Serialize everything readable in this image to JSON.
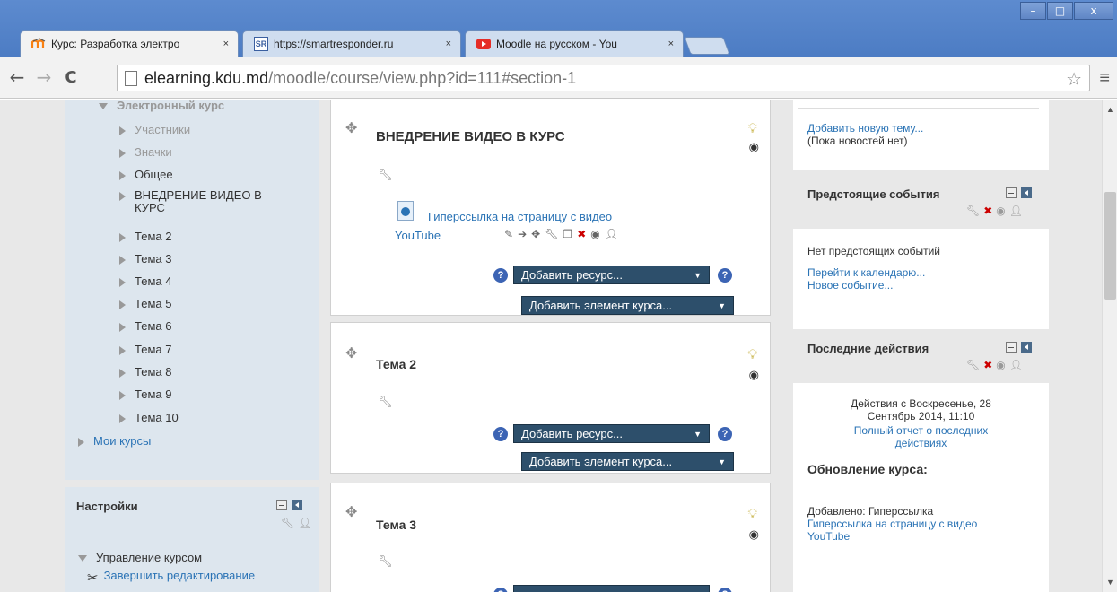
{
  "browser": {
    "tabs": [
      {
        "favicon": "moodle-favicon",
        "title": "Курс: Разработка электро",
        "active": true
      },
      {
        "favicon": "SR",
        "title": "https://smartresponder.ru",
        "active": false
      },
      {
        "favicon": "youtube-favicon",
        "title": "Moodle на русском - You",
        "active": false
      }
    ],
    "tab_close": "×",
    "window_buttons": [
      "–",
      "□",
      "x"
    ],
    "url_host": "elearning.kdu.md",
    "url_path": "/moodle/course/view.php?id=111#section-1",
    "back": "←",
    "forward": "→",
    "reload": "C",
    "star": "☆",
    "menu": "≡"
  },
  "nav": {
    "top_item": "Электронный курс",
    "items": [
      {
        "label": "Участники",
        "grey": true
      },
      {
        "label": "Значки",
        "grey": true
      },
      {
        "label": "Общее",
        "grey": false
      },
      {
        "label": "ВНЕДРЕНИЕ ВИДЕО В КУРС",
        "grey": false
      },
      {
        "label": "Тема 2",
        "grey": false
      },
      {
        "label": "Тема 3",
        "grey": false
      },
      {
        "label": "Тема 4",
        "grey": false
      },
      {
        "label": "Тема 5",
        "grey": false
      },
      {
        "label": "Тема 6",
        "grey": false
      },
      {
        "label": "Тема 7",
        "grey": false
      },
      {
        "label": "Тема 8",
        "grey": false
      },
      {
        "label": "Тема 9",
        "grey": false
      },
      {
        "label": "Тема 10",
        "grey": false
      }
    ],
    "my_courses": "Мои курсы"
  },
  "settings": {
    "title": "Настройки",
    "course_admin": "Управление курсом",
    "finish_editing": "Завершить редактирование"
  },
  "sections": [
    {
      "title": "ВНЕДРЕНИЕ ВИДЕО В КУРС",
      "resource_line1": "Гиперссылка на страницу с видео",
      "resource_line2": "YouTube",
      "add_resource": "Добавить ресурс...",
      "add_activity": "Добавить элемент курса..."
    },
    {
      "title": "Тема 2",
      "add_resource": "Добавить ресурс...",
      "add_activity": "Добавить элемент курса..."
    },
    {
      "title": "Тема 3"
    }
  ],
  "news": {
    "add_topic": "Добавить новую тему...",
    "no_news": "(Пока новостей нет)"
  },
  "upcoming": {
    "title": "Предстоящие события",
    "none": "Нет предстоящих событий",
    "go_calendar": "Перейти к календарю...",
    "new_event": "Новое событие..."
  },
  "recent": {
    "title": "Последние действия",
    "since_line1": "Действия с Воскресенье, 28",
    "since_line2": "Сентябрь 2014, 11:10",
    "full_report_line1": "Полный отчет о последних",
    "full_report_line2": "действиях",
    "course_updates": "Обновление курса:",
    "added": "Добавлено: Гиперссылка",
    "added_link_line1": "Гиперссылка на страницу с видео",
    "added_link_line2": "YouTube"
  },
  "help_glyph": "?",
  "colors": {
    "link": "#2a73b5",
    "select_bg": "#2d4f6b",
    "nav_bg": "#dde6ee",
    "help_bg": "#3c64b4"
  }
}
